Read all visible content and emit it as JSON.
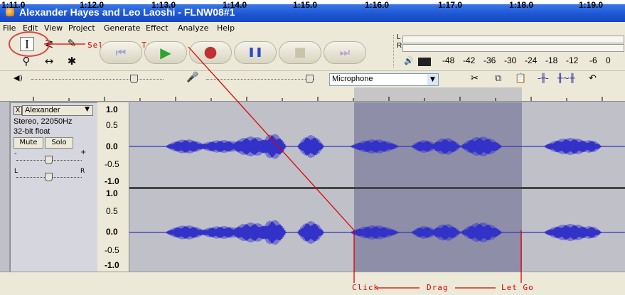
{
  "window": {
    "title": "Alexander Hayes and Leo Laoshi - FLNW08#1"
  },
  "menu": [
    "File",
    "Edit",
    "View",
    "Project",
    "Generate",
    "Effect",
    "Analyze",
    "Help"
  ],
  "tools": {
    "selection_glyph": "I",
    "envelope_glyph": "≷",
    "draw_glyph": "✎",
    "zoom_glyph": "⚲",
    "timeshift_glyph": "↔",
    "multi_glyph": "✱"
  },
  "transport": {
    "skip_start": "⏮",
    "play": "▶",
    "record": "●",
    "pause": "❚❚",
    "stop": "■",
    "skip_end": "⏭"
  },
  "meter": {
    "left_label": "L",
    "right_label": "R",
    "scale": [
      "-48",
      "-42",
      "-36",
      "-30",
      "-24",
      "-18",
      "-12",
      "-6",
      "0"
    ]
  },
  "mixer": {
    "input_source": "Microphone"
  },
  "ruler": {
    "ticks": [
      "1:11.0",
      "1:12.0",
      "1:13.0",
      "1:14.0",
      "1:15.0",
      "1:16.0",
      "1:17.0",
      "1:18.0",
      "1:19.0"
    ]
  },
  "track": {
    "name": "Alexander",
    "format": "Stereo, 22050Hz",
    "bit_depth": "32-bit float",
    "mute_label": "Mute",
    "solo_label": "Solo",
    "pan_left": "L",
    "pan_right": "R",
    "gain_minus": "-",
    "gain_plus": "+",
    "close_glyph": "X",
    "menu_glyph": "▼"
  },
  "vruler_top": [
    "1.0",
    "0.5",
    "0.0",
    "-0.5",
    "-1.0"
  ],
  "vruler_bottom": [
    "1.0",
    "0.5",
    "0.0",
    "-0.5",
    "-1.0"
  ],
  "annotations": {
    "selection_tool": "Selection Tool",
    "click": "Click",
    "drag": "Drag",
    "let_go": "Let Go"
  },
  "colors": {
    "title_bar": "#1d56d3",
    "waveform": "#3232c8",
    "selection": "#8e8ea8",
    "annotation": "#dd0000"
  }
}
